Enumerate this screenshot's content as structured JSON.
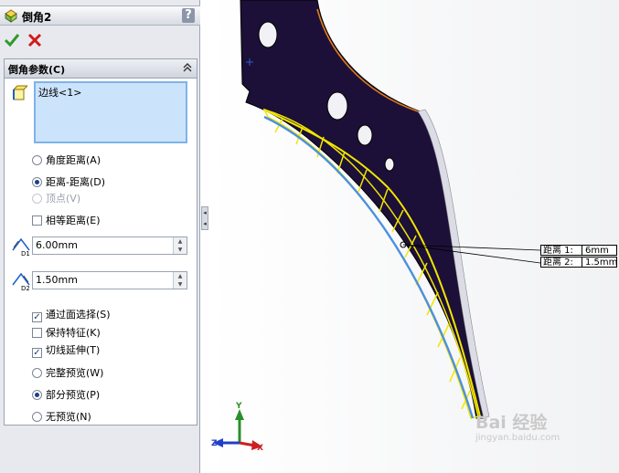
{
  "panel": {
    "title": "倒角2",
    "help": "?",
    "ok_icon": "checkmark-icon",
    "cancel_icon": "cross-icon",
    "group_title": "倒角参数(C)",
    "edge_list_item": "边线<1>",
    "radios_type": [
      {
        "label": "角度距离(A)",
        "selected": false,
        "enabled": true
      },
      {
        "label": "距离-距离(D)",
        "selected": true,
        "enabled": true
      },
      {
        "label": "顶点(V)",
        "selected": false,
        "enabled": false
      }
    ],
    "equal_distance": {
      "label": "相等距离(E)",
      "checked": false
    },
    "d1": {
      "label": "D1",
      "value": "6.00mm"
    },
    "d2": {
      "label": "D2",
      "value": "1.50mm"
    },
    "checks": [
      {
        "label": "通过面选择(S)",
        "checked": true
      },
      {
        "label": "保持特征(K)",
        "checked": false
      },
      {
        "label": "切线延伸(T)",
        "checked": true
      }
    ],
    "radios_preview": [
      {
        "label": "完整预览(W)",
        "selected": false
      },
      {
        "label": "部分预览(P)",
        "selected": true
      },
      {
        "label": "无预览(N)",
        "selected": false
      }
    ]
  },
  "viewport": {
    "callout1": {
      "label": "距离 1:",
      "value": "6mm"
    },
    "callout2": {
      "label": "距离 2:",
      "value": "1.5mm"
    },
    "triad": {
      "y": "Y",
      "z": "Z",
      "x": "X"
    },
    "watermark": "Bai 经验",
    "watermark_sub": "jingyan.baidu.com"
  },
  "colors": {
    "part_body": "#1c1038",
    "chamfer_preview": "#f2e600",
    "selected_edge": "#4a90e2",
    "accent": "#1c3f8a"
  }
}
